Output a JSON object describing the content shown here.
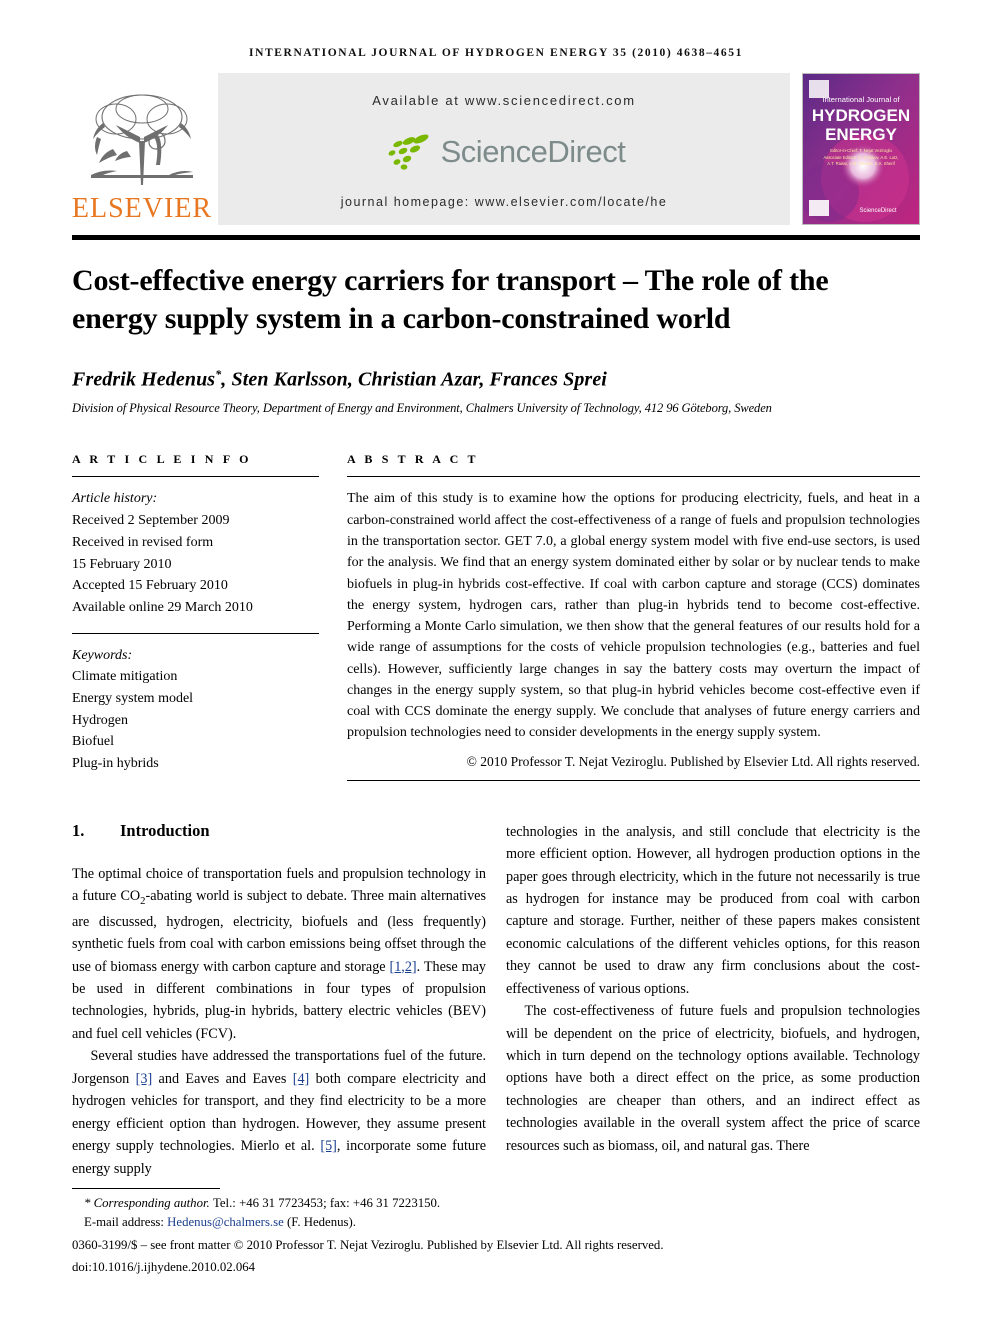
{
  "running_head": "International Journal of Hydrogen Energy 35 (2010) 4638–4651",
  "masthead": {
    "publisher_name": "ELSEVIER",
    "available_at": "Available at www.sciencedirect.com",
    "sciencedirect_word": "ScienceDirect",
    "journal_homepage": "journal homepage: www.elsevier.com/locate/he",
    "cover": {
      "line1": "International Journal of",
      "line2": "HYDROGEN",
      "line3": "ENERGY",
      "editor_label": "Editor-in-Chief:",
      "editor_name": "T. Nejat Veziroglu",
      "assoc_label": "Associate Editors:",
      "assoc_names": "D. Dunikov, A.E. Lutz, T.N. Veziroglu, A.M. Anani, W. Grochala, A.T. Raissi, L.M. Gandía, S.A. Sherif, D.A.J. Rand",
      "footer_brand": "ScienceDirect"
    },
    "colors": {
      "elsevier_orange": "#E87722",
      "sciencedirect_green": "#7AB800",
      "sciencedirect_gray": "#7E8B8B",
      "banner_bg": "#EBEBEB",
      "cover_purple": "#6B2D7A",
      "cover_magenta": "#C0257F"
    }
  },
  "article": {
    "title": "Cost-effective energy carriers for transport – The role of the energy supply system in a carbon-constrained world",
    "authors": "Fredrik Hedenus",
    "authors_rest": ", Sten Karlsson, Christian Azar, Frances Sprei",
    "corresponding_marker": "*",
    "affiliation": "Division of Physical Resource Theory, Department of Energy and Environment, Chalmers University of Technology, 412 96 Göteborg, Sweden"
  },
  "article_info": {
    "heading": "A R T I C L E   I N F O",
    "history_label": "Article history:",
    "history": [
      "Received 2 September 2009",
      "Received in revised form",
      "15 February 2010",
      "Accepted 15 February 2010",
      "Available online 29 March 2010"
    ],
    "keywords_label": "Keywords:",
    "keywords": [
      "Climate mitigation",
      "Energy system model",
      "Hydrogen",
      "Biofuel",
      "Plug-in hybrids"
    ]
  },
  "abstract": {
    "heading": "A B S T R A C T",
    "text": "The aim of this study is to examine how the options for producing electricity, fuels, and heat in a carbon-constrained world affect the cost-effectiveness of a range of fuels and propulsion technologies in the transportation sector. GET 7.0, a global energy system model with five end-use sectors, is used for the analysis. We find that an energy system dominated either by solar or by nuclear tends to make biofuels in plug-in hybrids cost-effective. If coal with carbon capture and storage (CCS) dominates the energy system, hydrogen cars, rather than plug-in hybrids tend to become cost-effective. Performing a Monte Carlo simulation, we then show that the general features of our results hold for a wide range of assumptions for the costs of vehicle propulsion technologies (e.g., batteries and fuel cells). However, sufficiently large changes in say the battery costs may overturn the impact of changes in the energy supply system, so that plug-in hybrid vehicles become cost-effective even if coal with CCS dominate the energy supply. We conclude that analyses of future energy carriers and propulsion technologies need to consider developments in the energy supply system.",
    "copyright": "© 2010 Professor T. Nejat Veziroglu. Published by Elsevier Ltd. All rights reserved."
  },
  "introduction": {
    "number": "1.",
    "title": "Introduction",
    "left_para_1_a": "The optimal choice of transportation fuels and propulsion technology in a future CO",
    "left_para_1_sub": "2",
    "left_para_1_b": "-abating world is subject to debate. Three main alternatives are discussed, hydrogen, electricity, biofuels and (less frequently) synthetic fuels from coal with carbon emissions being offset through the use of biomass energy with carbon capture and storage ",
    "cite_1": "[1,2]",
    "left_para_1_c": ". These may be used in different combinations in four types of propulsion technologies, hybrids, plug-in hybrids, battery electric vehicles (BEV) and fuel cell vehicles (FCV).",
    "left_para_2_a": "Several studies have addressed the transportations fuel of the future. Jorgenson ",
    "cite_3": "[3]",
    "left_para_2_b": " and Eaves and Eaves ",
    "cite_4": "[4]",
    "left_para_2_c": " both compare electricity and hydrogen vehicles for transport, and they find electricity to be a more energy efficient option than hydrogen. However, they assume present energy supply technologies. Mierlo et al. ",
    "cite_5": "[5]",
    "left_para_2_d": ", incorporate some future energy supply",
    "right_para_1": "technologies in the analysis, and still conclude that electricity is the more efficient option. However, all hydrogen production options in the paper goes through electricity, which in the future not necessarily is true as hydrogen for instance may be produced from coal with carbon capture and storage. Further, neither of these papers makes consistent economic calculations of the different vehicles options, for this reason they cannot be used to draw any firm conclusions about the cost-effectiveness of various options.",
    "right_para_2": "The cost-effectiveness of future fuels and propulsion technologies will be dependent on the price of electricity, biofuels, and hydrogen, which in turn depend on the technology options available. Technology options have both a direct effect on the price, as some production technologies are cheaper than others, and an indirect effect as technologies available in the overall system affect the price of scarce resources such as biomass, oil, and natural gas. There"
  },
  "footnote": {
    "marker": "*",
    "corresponding_label": "Corresponding author.",
    "tel": "Tel.: +46 31 7723453; fax: +46 31 7223150.",
    "email_label": "E-mail address:",
    "email": "Hedenus@chalmers.se",
    "email_owner": "(F. Hedenus).",
    "issn_line": "0360-3199/$ – see front matter © 2010 Professor T. Nejat Veziroglu. Published by Elsevier Ltd. All rights reserved.",
    "doi": "doi:10.1016/j.ijhydene.2010.02.064"
  }
}
